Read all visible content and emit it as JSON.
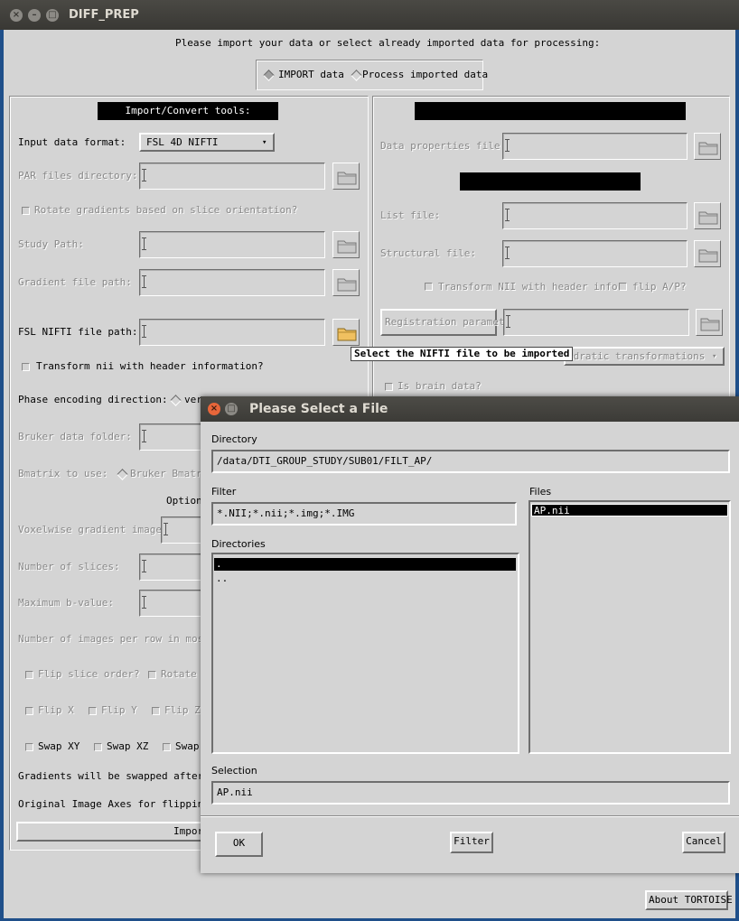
{
  "window": {
    "title": "DIFF_PREP"
  },
  "intro": "Please import your data or select already imported data for processing:",
  "mode": {
    "import_label": "IMPORT data",
    "process_label": "Process imported data"
  },
  "left": {
    "header": "Import/Convert tools:",
    "input_format_label": "Input data format:",
    "input_format_value": "FSL 4D NIFTI",
    "par_dir_label": "PAR files directory:",
    "rotate_label": "Rotate gradients based on slice orientation?",
    "study_path_label": "Study Path:",
    "gradient_path_label": "Gradient file path:",
    "nifti_path_label": "FSL NIFTI file path:",
    "transform_label": "Transform nii with header information?",
    "phase_label": "Phase encoding direction:",
    "phase_value": "ver",
    "bruker_label": "Bruker data folder:",
    "bmatrix_label": "Bmatrix to use:",
    "bmatrix_value": "Bruker Bmatri",
    "options_label": "Option",
    "voxelwise_label": "Voxelwise gradient image:",
    "num_slices_label": "Number of slices:",
    "max_bval_label": "Maximum b-value:",
    "mosaic_label": "Number of images per row in mosaic",
    "flip_slice_label": "Flip slice order?",
    "rotate_short_label": "Rotate",
    "flip_x": "Flip X",
    "flip_y": "Flip Y",
    "flip_z": "Flip Z",
    "swap_xy": "Swap XY",
    "swap_xz": "Swap XZ",
    "swap_yz": "Swap",
    "swapped_label": "Gradients will be swapped after be",
    "axes_label": "Original Image Axes for flipping:",
    "import_button": "Impor"
  },
  "right": {
    "data_props_label": "Data properties file:",
    "list_file_label": "List file:",
    "structural_label": "Structural file:",
    "transform_nii_label": "Transform NII with header info?",
    "flip_label": "flip A/P?",
    "registration_button": "Registration paramet",
    "transformation_value": "adratic transformations",
    "brain_label": "Is brain data?"
  },
  "tooltip": "Select the NIFTI file to be imported",
  "about_button": "About TORTOISE",
  "dialog": {
    "title": "Please Select a File",
    "directory_label": "Directory",
    "directory_value": "/data/DTI_GROUP_STUDY/SUB01/FILT_AP/",
    "filter_label": "Filter",
    "filter_value": "*.NII;*.nii;*.img;*.IMG",
    "files_label": "Files",
    "files": [
      "AP.nii"
    ],
    "directories_label": "Directories",
    "directories": [
      ".",
      ".."
    ],
    "selection_label": "Selection",
    "selection_value": "AP.nii",
    "ok_button": "OK",
    "filter_button": "Filter",
    "cancel_button": "Cancel"
  },
  "colors": {
    "background": "#d4d4d4",
    "titlebar": "#3c3b37",
    "close": "#e8663a",
    "desktop": "#1f4f8a"
  }
}
